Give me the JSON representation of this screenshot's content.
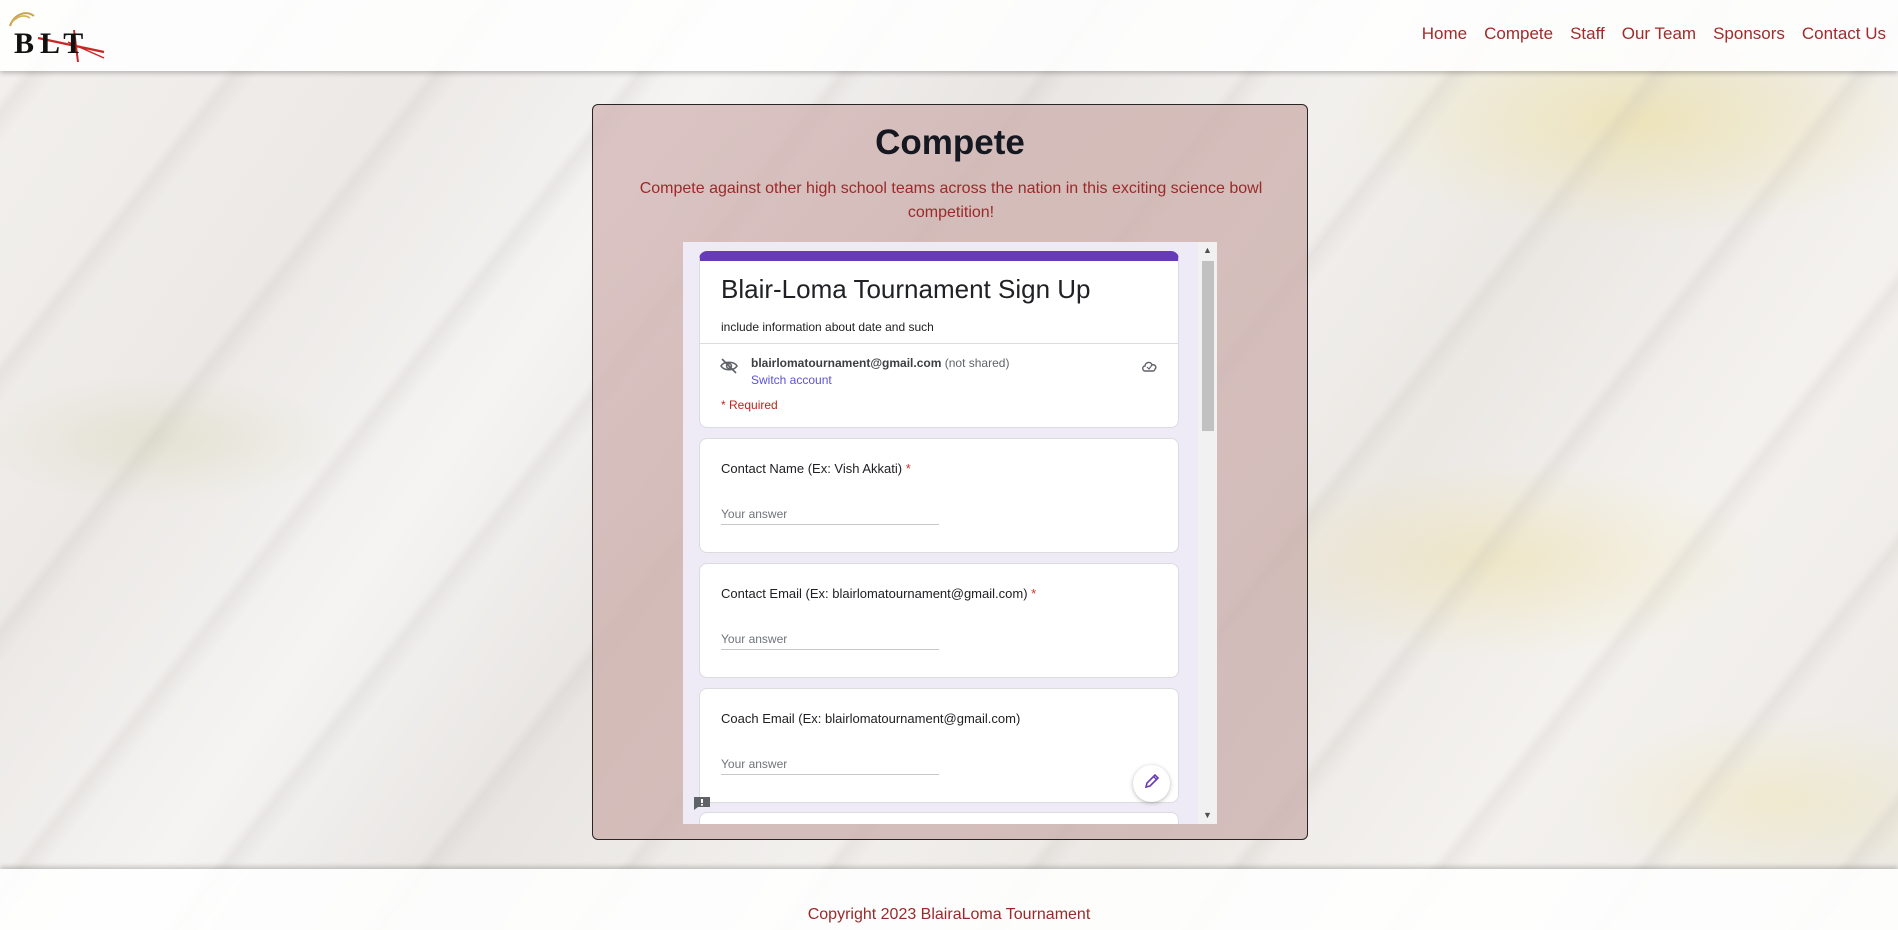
{
  "header": {
    "logo_text": "BLT",
    "nav": [
      "Home",
      "Compete",
      "Staff",
      "Our Team",
      "Sponsors",
      "Contact Us"
    ]
  },
  "main": {
    "title": "Compete",
    "description": "Compete against other high school teams across the nation in this exciting science bowl competition!"
  },
  "form": {
    "title": "Blair-Loma Tournament Sign Up",
    "subtitle": "include information about date and such",
    "account_email": "blairlomatournament@gmail.com",
    "account_note": "(not shared)",
    "switch_account": "Switch account",
    "required_note": "* Required",
    "questions": [
      {
        "label": "Contact Name (Ex: Vish Akkati)",
        "required": "*",
        "placeholder": "Your answer"
      },
      {
        "label": "Contact Email (Ex: blairlomatournament@gmail.com)",
        "required": "*",
        "placeholder": "Your answer"
      },
      {
        "label": "Coach Email (Ex: blairlomatournament@gmail.com)",
        "required": "",
        "placeholder": "Your answer"
      }
    ]
  },
  "footer": {
    "copyright": "Copyright 2023 BlairaLoma Tournament"
  },
  "colors": {
    "brand_red": "#a02c2c",
    "form_accent": "#673ab7",
    "required_red": "#d93025"
  },
  "icons": [
    "hidden-eye-icon",
    "cloud-icon",
    "feedback-icon",
    "pencil-icon",
    "scroll-up-arrow-icon",
    "scroll-down-arrow-icon"
  ]
}
